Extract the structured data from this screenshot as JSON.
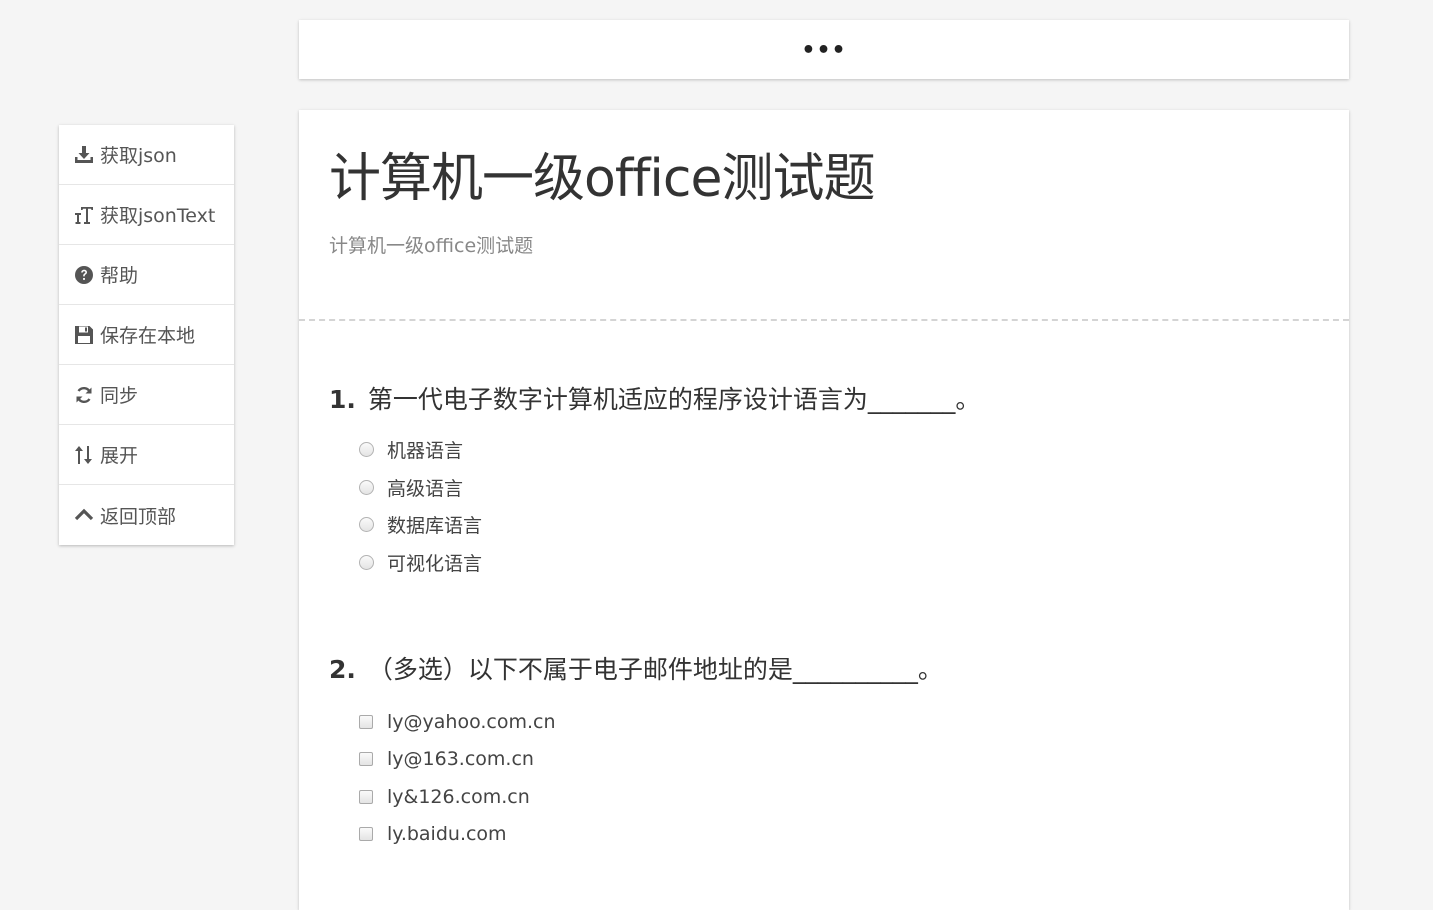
{
  "topbar": {
    "text": "•••"
  },
  "sidebar": {
    "items": [
      {
        "label": "获取json",
        "icon": "download-icon"
      },
      {
        "label": "获取jsonText",
        "icon": "text-height-icon"
      },
      {
        "label": "帮助",
        "icon": "question-circle-icon"
      },
      {
        "label": "保存在本地",
        "icon": "save-icon"
      },
      {
        "label": "同步",
        "icon": "refresh-icon"
      },
      {
        "label": "展开",
        "icon": "sort-icon"
      },
      {
        "label": "返回顶部",
        "icon": "chevron-up-icon"
      }
    ]
  },
  "survey": {
    "title": "计算机一级office测试题",
    "subtitle": "计算机一级office测试题",
    "questions": [
      {
        "number": "1.",
        "text": "第一代电子数字计算机适应的程序设计语言为_______。",
        "type": "radio",
        "options": [
          "机器语言",
          "高级语言",
          "数据库语言",
          "可视化语言"
        ]
      },
      {
        "number": "2.",
        "text": "（多选）以下不属于电子邮件地址的是__________。",
        "type": "checkbox",
        "options": [
          "ly@yahoo.com.cn",
          "ly@163.com.cn",
          "ly&126.com.cn",
          "ly.baidu.com"
        ]
      }
    ]
  },
  "colors": {
    "background": "#f5f5f5",
    "card": "#ffffff",
    "text": "#333333",
    "muted": "#888888",
    "icon": "#555555"
  }
}
